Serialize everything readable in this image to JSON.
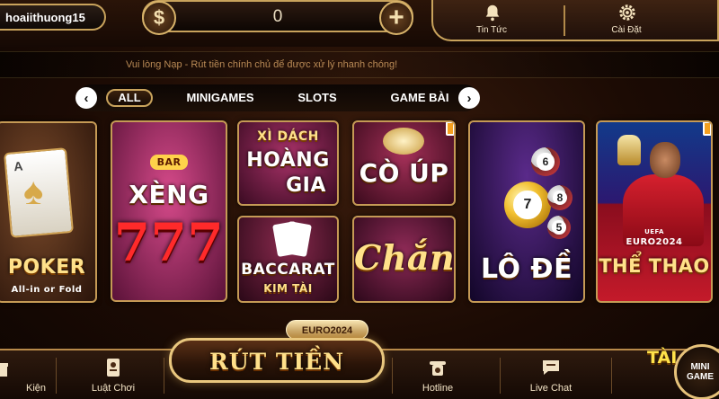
{
  "header": {
    "username": "hoaiithuong15",
    "balance": "0",
    "currency_icon": "dollar-icon",
    "add_icon": "plus-icon",
    "news_label": "Tin Tức",
    "settings_label": "Cài Đặt"
  },
  "notice": {
    "text": "Vui lòng Nạp - Rút tiền chính chủ để được xử lý nhanh chóng!"
  },
  "tabs": {
    "items": [
      "ALL",
      "MINIGAMES",
      "SLOTS",
      "GAME BÀI"
    ],
    "active": "ALL"
  },
  "games": {
    "poker": {
      "title": "POKER",
      "subtitle": "All-in or Fold"
    },
    "xeng": {
      "title": "XÈNG",
      "number": "777",
      "badge": "BAR"
    },
    "xidach": {
      "line1": "XÌ DÁCH",
      "line2": "HOÀNG",
      "line3": "GIA"
    },
    "baccarat": {
      "title": "BACCARAT",
      "subtitle": "KIM TÀI"
    },
    "coup": {
      "title": "CÒ ÚP"
    },
    "chan": {
      "title": "Chắn"
    },
    "lode": {
      "title": "LÔ ĐỀ",
      "balls": [
        "6",
        "7",
        "8",
        "5"
      ]
    },
    "thethao": {
      "title": "THỂ THAO",
      "badge": "EURO2024",
      "small": "UEFA"
    }
  },
  "footer": {
    "events_label": "Kiện",
    "rules_label": "Luật Chơi",
    "withdraw_label": "RÚT TIỀN",
    "euro_badge": "EURO2024",
    "hotline_label": "Hotline",
    "chat_label": "Live Chat",
    "mini_tai": "TÀI",
    "mini_label": "MINI GAME"
  },
  "colors": {
    "gold": "#c9a35c",
    "accent_text": "#ffe18a",
    "background": "#1c0b04"
  }
}
